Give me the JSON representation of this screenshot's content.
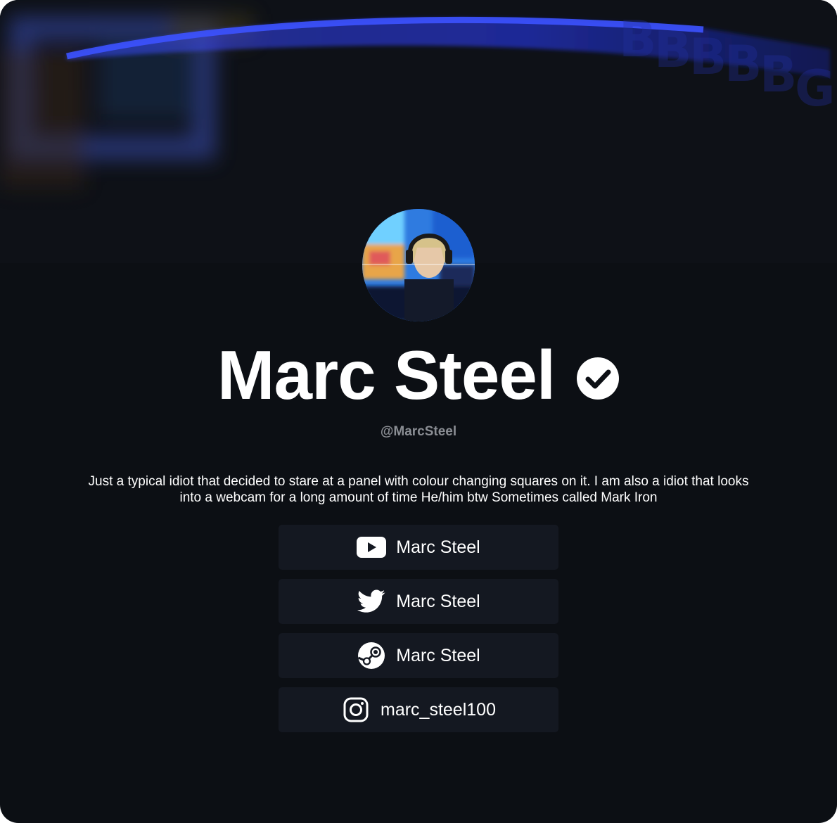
{
  "profile": {
    "name": "Marc Steel",
    "handle": "@MarcSteel",
    "bio": "Just a typical idiot that decided to stare at a panel with colour changing squares on it. I am also a idiot that looks into a webcam for a long amount of time He/him btw Sometimes called Mark Iron",
    "verified_icon": "verified-check-icon"
  },
  "links": [
    {
      "label": "Marc Steel",
      "icon": "youtube-icon"
    },
    {
      "label": "Marc Steel",
      "icon": "twitter-icon"
    },
    {
      "label": "Marc Steel",
      "icon": "steam-icon"
    },
    {
      "label": "marc_steel100",
      "icon": "instagram-icon"
    }
  ],
  "colors": {
    "background": "#0c0f14",
    "banner": "#0e1117",
    "link_button": "#141821",
    "text": "#ffffff",
    "handle": "#8a8d93",
    "accent_blue": "#2a3cff"
  }
}
